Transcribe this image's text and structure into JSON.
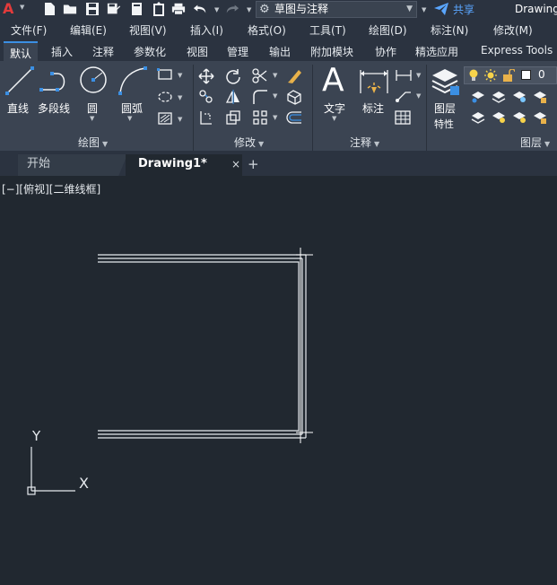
{
  "quick_access": {
    "workspace_label": "草图与注释",
    "share_label": "共享",
    "document_title": "Drawing"
  },
  "menu": [
    "文件(F)",
    "编辑(E)",
    "视图(V)",
    "插入(I)",
    "格式(O)",
    "工具(T)",
    "绘图(D)",
    "标注(N)",
    "修改(M)"
  ],
  "ribbon_tabs": [
    "默认",
    "插入",
    "注释",
    "参数化",
    "视图",
    "管理",
    "输出",
    "附加模块",
    "协作",
    "精选应用",
    "Express Tools"
  ],
  "ribbon": {
    "draw": {
      "title": "绘图",
      "line": "直线",
      "polyline": "多段线",
      "circle": "圆",
      "arc": "圆弧"
    },
    "modify": {
      "title": "修改"
    },
    "annotation": {
      "title": "注释",
      "text": "文字",
      "dimension": "标注"
    },
    "layers": {
      "title": "图层",
      "properties_line1": "图层",
      "properties_line2": "特性",
      "current_layer": "0"
    }
  },
  "doc_tabs": {
    "start": "开始",
    "drawing": "Drawing1*",
    "close": "×",
    "add": "+"
  },
  "canvas": {
    "viewport_label": "[−][俯视][二维线框]",
    "ucs_x": "X",
    "ucs_y": "Y"
  },
  "colors": {
    "canvas_bg": "#212830",
    "ribbon_bg": "#3b4452",
    "bar_bg": "#2b3340",
    "accent_blue": "#3b8fe3",
    "logo_red": "#e23b3b"
  }
}
